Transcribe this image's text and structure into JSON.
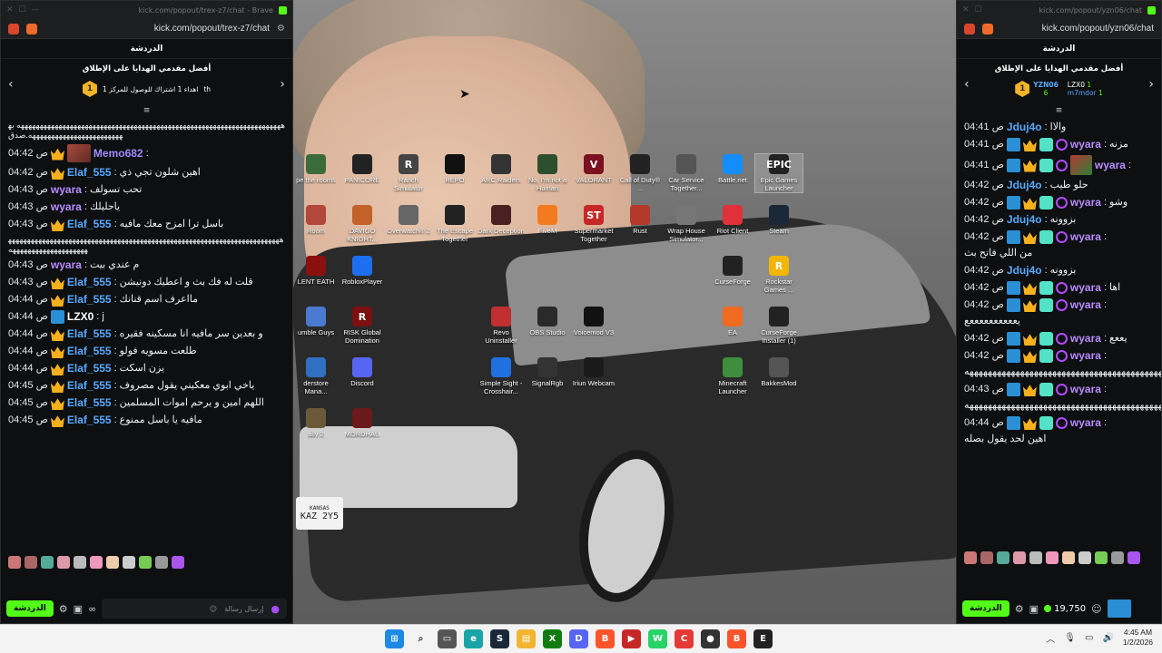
{
  "left_window": {
    "title": "kick.com/popout/trex-z7/chat - Brave",
    "url": "kick.com/popout/trex-z7/chat",
    "chat_header": "الدردشة",
    "gifters_title": "أفضل مقدمي الهدايا على الإطلاق",
    "gifters_note": "اهداء 1 اشتراك للوصول للمركز 1",
    "gifters_rank": "1",
    "gifters_suffix": "th",
    "messages": [
      {
        "time": "",
        "user": "",
        "text": "ههههههههههههههههههههههههههههههههههههههههههههههههههههههههههههههههههههههه بهههههههههههههههههههههههههه.صدق",
        "color": "#fff",
        "badges": [],
        "long": true
      },
      {
        "time": "04:42 ص",
        "user": "Memo682",
        "text": "",
        "color": "#a28bff",
        "badges": [
          "crown",
          "av"
        ],
        "long": false
      },
      {
        "time": "04:42 ص",
        "user": "Elaf_555",
        "text": "اهين شلون تجي ذي",
        "color": "#5aa9ff",
        "badges": [
          "crown"
        ],
        "long": false
      },
      {
        "time": "04:43 ص",
        "user": "wyara",
        "text": "تحب تسولف",
        "color": "#b98cff",
        "badges": [],
        "long": false
      },
      {
        "time": "04:43 ص",
        "user": "wyara",
        "text": "ياحليلك",
        "color": "#b98cff",
        "badges": [],
        "long": false
      },
      {
        "time": "04:43 ص",
        "user": "Elaf_555",
        "text": "باسل ترا امزح معك مافيه",
        "color": "#5aa9ff",
        "badges": [
          "crown"
        ],
        "long": false
      },
      {
        "time": "",
        "user": "",
        "text": "هههههههههههههههههههههههههههههههههههههههههههههههههههههههههههههههههههههههههههههههههههههههههههههه",
        "color": "#fff",
        "badges": [],
        "long": true
      },
      {
        "time": "04:43 ص",
        "user": "wyara",
        "text": "م عندي بيت",
        "color": "#b98cff",
        "badges": [],
        "long": false
      },
      {
        "time": "04:43 ص",
        "user": "Elaf_555",
        "text": "قلت له فك بث و اعطيك دونيشن",
        "color": "#5aa9ff",
        "badges": [
          "crown"
        ],
        "long": false
      },
      {
        "time": "04:44 ص",
        "user": "Elaf_555",
        "text": "مااعرف اسم قنانك",
        "color": "#5aa9ff",
        "badges": [
          "crown"
        ],
        "long": false
      },
      {
        "time": "04:44 ص",
        "user": "LZX0",
        "text": "j",
        "color": "#ffffff",
        "badges": [
          "blue"
        ],
        "long": false
      },
      {
        "time": "04:44 ص",
        "user": "Elaf_555",
        "text": "و بعدين سر مافيه انا مسكينه فقيره",
        "color": "#5aa9ff",
        "badges": [
          "crown"
        ],
        "long": false
      },
      {
        "time": "04:44 ص",
        "user": "Elaf_555",
        "text": "طلعت مسويه فولو",
        "color": "#5aa9ff",
        "badges": [
          "crown"
        ],
        "long": false
      },
      {
        "time": "04:44 ص",
        "user": "Elaf_555",
        "text": "يزن اسكت",
        "color": "#5aa9ff",
        "badges": [
          "crown"
        ],
        "long": false
      },
      {
        "time": "04:45 ص",
        "user": "Elaf_555",
        "text": "ياخي ابوي معكيني يقول مصروف",
        "color": "#5aa9ff",
        "badges": [
          "crown"
        ],
        "long": false
      },
      {
        "time": "04:45 ص",
        "user": "Elaf_555",
        "text": "اللهم امين و يرحم اموات المسلمين",
        "color": "#5aa9ff",
        "badges": [
          "crown"
        ],
        "long": false
      },
      {
        "time": "04:45 ص",
        "user": "Elaf_555",
        "text": "مافيه يا باسل ممنوع",
        "color": "#5aa9ff",
        "badges": [
          "crown"
        ],
        "long": false
      }
    ],
    "input_placeholder": "إرسال رسالة",
    "chat_button": "الدردشة"
  },
  "right_window": {
    "url": "kick.com/popout/yzn06/chat",
    "title": "kick.com/popout/yzn06/chat",
    "chat_header": "الدردشة",
    "gifters_title": "أفضل مقدمي الهدايا على الإطلاق",
    "gifters": [
      {
        "rank": "1",
        "name": "YZN06",
        "count": "6"
      },
      {
        "name": "LZX0",
        "count": "1"
      },
      {
        "name": "m7mdor",
        "count": "1"
      }
    ],
    "messages": [
      {
        "time": "04:41 ص",
        "user": "Jduj4o",
        "text": "والاا",
        "color": "#5aa9ff",
        "badges": [],
        "long": false
      },
      {
        "time": "04:41 ص",
        "user": "wyara",
        "text": "مزنه",
        "color": "#b98cff",
        "badges": [
          "blue",
          "crown",
          "green",
          "ring"
        ],
        "long": false
      },
      {
        "time": "04:41 ص",
        "user": "wyara",
        "text": "",
        "color": "#b98cff",
        "badges": [
          "blue",
          "crown",
          "green",
          "ring",
          "av2"
        ],
        "long": false
      },
      {
        "time": "04:42 ص",
        "user": "Jduj4o",
        "text": "حلو طيب",
        "color": "#5aa9ff",
        "badges": [],
        "long": false
      },
      {
        "time": "04:42 ص",
        "user": "wyara",
        "text": "وشو",
        "color": "#b98cff",
        "badges": [
          "blue",
          "crown",
          "green",
          "ring"
        ],
        "long": false
      },
      {
        "time": "04:42 ص",
        "user": "Jduj4o",
        "text": "بزوونه",
        "color": "#5aa9ff",
        "badges": [],
        "long": false
      },
      {
        "time": "04:42 ص",
        "user": "wyara",
        "text": "من اللي فاتح بث",
        "color": "#b98cff",
        "badges": [
          "blue",
          "crown",
          "green",
          "ring"
        ],
        "long": false
      },
      {
        "time": "04:42 ص",
        "user": "Jduj4o",
        "text": "بزوونه",
        "color": "#5aa9ff",
        "badges": [],
        "long": false
      },
      {
        "time": "04:42 ص",
        "user": "wyara",
        "text": "اها",
        "color": "#b98cff",
        "badges": [
          "blue",
          "crown",
          "green",
          "ring"
        ],
        "long": false
      },
      {
        "time": "04:42 ص",
        "user": "wyara",
        "text": "يععععععععععع",
        "color": "#b98cff",
        "badges": [
          "blue",
          "crown",
          "green",
          "ring"
        ],
        "long": false
      },
      {
        "time": "04:42 ص",
        "user": "wyara",
        "text": "يععع",
        "color": "#b98cff",
        "badges": [
          "blue",
          "crown",
          "green",
          "ring"
        ],
        "long": false
      },
      {
        "time": "04:42 ص",
        "user": "wyara",
        "text": "هههههههههههههههههههههههههههههههههههههههههههههههههههههههههههههههه",
        "color": "#b98cff",
        "badges": [
          "blue",
          "crown",
          "green",
          "ring"
        ],
        "long": false
      },
      {
        "time": "04:43 ص",
        "user": "wyara",
        "text": "هههههههههههههههههههههههههههههههههههههههههههه",
        "color": "#b98cff",
        "badges": [
          "blue",
          "crown",
          "green",
          "ring"
        ],
        "long": false
      },
      {
        "time": "04:44 ص",
        "user": "wyara",
        "text": "اهين لحد يقول بصله",
        "color": "#b98cff",
        "badges": [
          "blue",
          "crown",
          "green",
          "ring"
        ],
        "long": false
      }
    ],
    "points": "19,750",
    "chat_button": "الدردشة"
  },
  "desktop": {
    "icons": [
      {
        "label": "pe the rooms",
        "color": "#3b6b3b",
        "glyph": "",
        "col": 0,
        "row": 0
      },
      {
        "label": "PANICORE",
        "color": "#222",
        "glyph": "",
        "col": 1,
        "row": 0
      },
      {
        "label": "Ranch Simulator",
        "color": "#444",
        "glyph": "R",
        "col": 2,
        "row": 0
      },
      {
        "label": "REPO",
        "color": "#111",
        "glyph": "",
        "col": 3,
        "row": 0
      },
      {
        "label": "ARC Raiders",
        "color": "#333",
        "glyph": "",
        "col": 4,
        "row": 0
      },
      {
        "label": "No, I'm not a Human",
        "color": "#2e4f2e",
        "glyph": "",
        "col": 5,
        "row": 0
      },
      {
        "label": "VALORANT",
        "color": "#7a1020",
        "glyph": "V",
        "col": 6,
        "row": 0
      },
      {
        "label": "Call of Duty® ...",
        "color": "#222",
        "glyph": "",
        "col": 7,
        "row": 0
      },
      {
        "label": "Car Service Together...",
        "color": "#555",
        "glyph": "",
        "col": 8,
        "row": 0
      },
      {
        "label": "Battle.net",
        "color": "#148eff",
        "glyph": "",
        "col": 9,
        "row": 0
      },
      {
        "label": "Epic Games Launcher",
        "color": "#222",
        "glyph": "EPIC",
        "col": 10,
        "row": 0
      },
      {
        "label": "Room",
        "color": "#b2473b",
        "glyph": "",
        "col": 0,
        "row": 1
      },
      {
        "label": "DAVIGO KNIGHT...",
        "color": "#c2612a",
        "glyph": "",
        "col": 1,
        "row": 1
      },
      {
        "label": "Overwatch® 2",
        "color": "#666",
        "glyph": "",
        "col": 2,
        "row": 1
      },
      {
        "label": "The Escape Together",
        "color": "#222",
        "glyph": "",
        "col": 3,
        "row": 1
      },
      {
        "label": "Dark Deception",
        "color": "#4a2020",
        "glyph": "",
        "col": 4,
        "row": 1
      },
      {
        "label": "FiveM",
        "color": "#f47a1f",
        "glyph": "",
        "col": 5,
        "row": 1
      },
      {
        "label": "Supermarket Together",
        "color": "#c62828",
        "glyph": "ST",
        "col": 6,
        "row": 1
      },
      {
        "label": "Rust",
        "color": "#b33a2a",
        "glyph": "",
        "col": 7,
        "row": 1
      },
      {
        "label": "Wrap House Simulator...",
        "color": "#777",
        "glyph": "",
        "col": 8,
        "row": 1
      },
      {
        "label": "Riot Client",
        "color": "#e0303a",
        "glyph": "",
        "col": 9,
        "row": 1
      },
      {
        "label": "Steam",
        "color": "#1b2838",
        "glyph": "",
        "col": 10,
        "row": 1
      },
      {
        "label": "LENT EATH",
        "color": "#8a1010",
        "glyph": "",
        "col": 0,
        "row": 2
      },
      {
        "label": "RobloxPlayer",
        "color": "#1e6ff0",
        "glyph": "",
        "col": 1,
        "row": 2
      },
      {
        "label": "CurseForge",
        "color": "#222",
        "glyph": "",
        "col": 9,
        "row": 2
      },
      {
        "label": "Rockstar Games ...",
        "color": "#f2b600",
        "glyph": "R",
        "col": 10,
        "row": 2
      },
      {
        "label": "umble Guys",
        "color": "#4a7ad0",
        "glyph": "",
        "col": 0,
        "row": 3
      },
      {
        "label": "RISK Global Domination",
        "color": "#7a1010",
        "glyph": "R",
        "col": 1,
        "row": 3
      },
      {
        "label": "Revo Uninstaller",
        "color": "#c03030",
        "glyph": "",
        "col": 4,
        "row": 3
      },
      {
        "label": "OBS Studio",
        "color": "#2a2a2a",
        "glyph": "",
        "col": 5,
        "row": 3
      },
      {
        "label": "Voicemod V3",
        "color": "#111",
        "glyph": "",
        "col": 6,
        "row": 3
      },
      {
        "label": "EA",
        "color": "#f06a20",
        "glyph": "",
        "col": 9,
        "row": 3
      },
      {
        "label": "CurseForge Installer (1)",
        "color": "#222",
        "glyph": "",
        "col": 10,
        "row": 3
      },
      {
        "label": "derstore Mana...",
        "color": "#3070c0",
        "glyph": "",
        "col": 0,
        "row": 4
      },
      {
        "label": "Discord",
        "color": "#5865f2",
        "glyph": "",
        "col": 1,
        "row": 4
      },
      {
        "label": "Simple Sight - Crosshair...",
        "color": "#2070e0",
        "glyph": "",
        "col": 4,
        "row": 4
      },
      {
        "label": "SignalRgb",
        "color": "#333",
        "glyph": "",
        "col": 5,
        "row": 4
      },
      {
        "label": "Iriun Webcam",
        "color": "#1a1a1a",
        "glyph": "",
        "col": 6,
        "row": 4
      },
      {
        "label": "Minecraft Launcher",
        "color": "#3e8e3e",
        "glyph": "",
        "col": 9,
        "row": 4
      },
      {
        "label": "BakkesMod",
        "color": "#555",
        "glyph": "",
        "col": 10,
        "row": 4
      },
      {
        "label": "ally 2",
        "color": "#6a5a3a",
        "glyph": "",
        "col": 0,
        "row": 5
      },
      {
        "label": "MORDHAU",
        "color": "#6a1a1a",
        "glyph": "",
        "col": 1,
        "row": 5
      }
    ],
    "plate_top": "KANSAS",
    "plate": "KAZ 2Y5"
  },
  "taskbar": {
    "apps": [
      {
        "name": "windows-start",
        "color": "#1e88e5",
        "glyph": "⊞"
      },
      {
        "name": "search",
        "color": "transparent",
        "glyph": "⌕"
      },
      {
        "name": "task-view",
        "color": "#555",
        "glyph": "▭"
      },
      {
        "name": "edge",
        "color": "#1ba4a8",
        "glyph": "e"
      },
      {
        "name": "steam",
        "color": "#1b2838",
        "glyph": "S"
      },
      {
        "name": "file-explorer",
        "color": "#f2b431",
        "glyph": "▤"
      },
      {
        "name": "xbox",
        "color": "#107c10",
        "glyph": "X"
      },
      {
        "name": "discord",
        "color": "#5865f2",
        "glyph": "D"
      },
      {
        "name": "brave",
        "color": "#fb542b",
        "glyph": "B"
      },
      {
        "name": "video-editor",
        "color": "#c62828",
        "glyph": "▶"
      },
      {
        "name": "whatsapp",
        "color": "#25d366",
        "glyph": "W"
      },
      {
        "name": "chrome",
        "color": "#e53935",
        "glyph": "C"
      },
      {
        "name": "obs",
        "color": "#333",
        "glyph": "●"
      },
      {
        "name": "brave-2",
        "color": "#fb542b",
        "glyph": "B"
      },
      {
        "name": "epic",
        "color": "#222",
        "glyph": "E"
      }
    ],
    "time": "4:45 AM",
    "date": "1/2/2026"
  }
}
